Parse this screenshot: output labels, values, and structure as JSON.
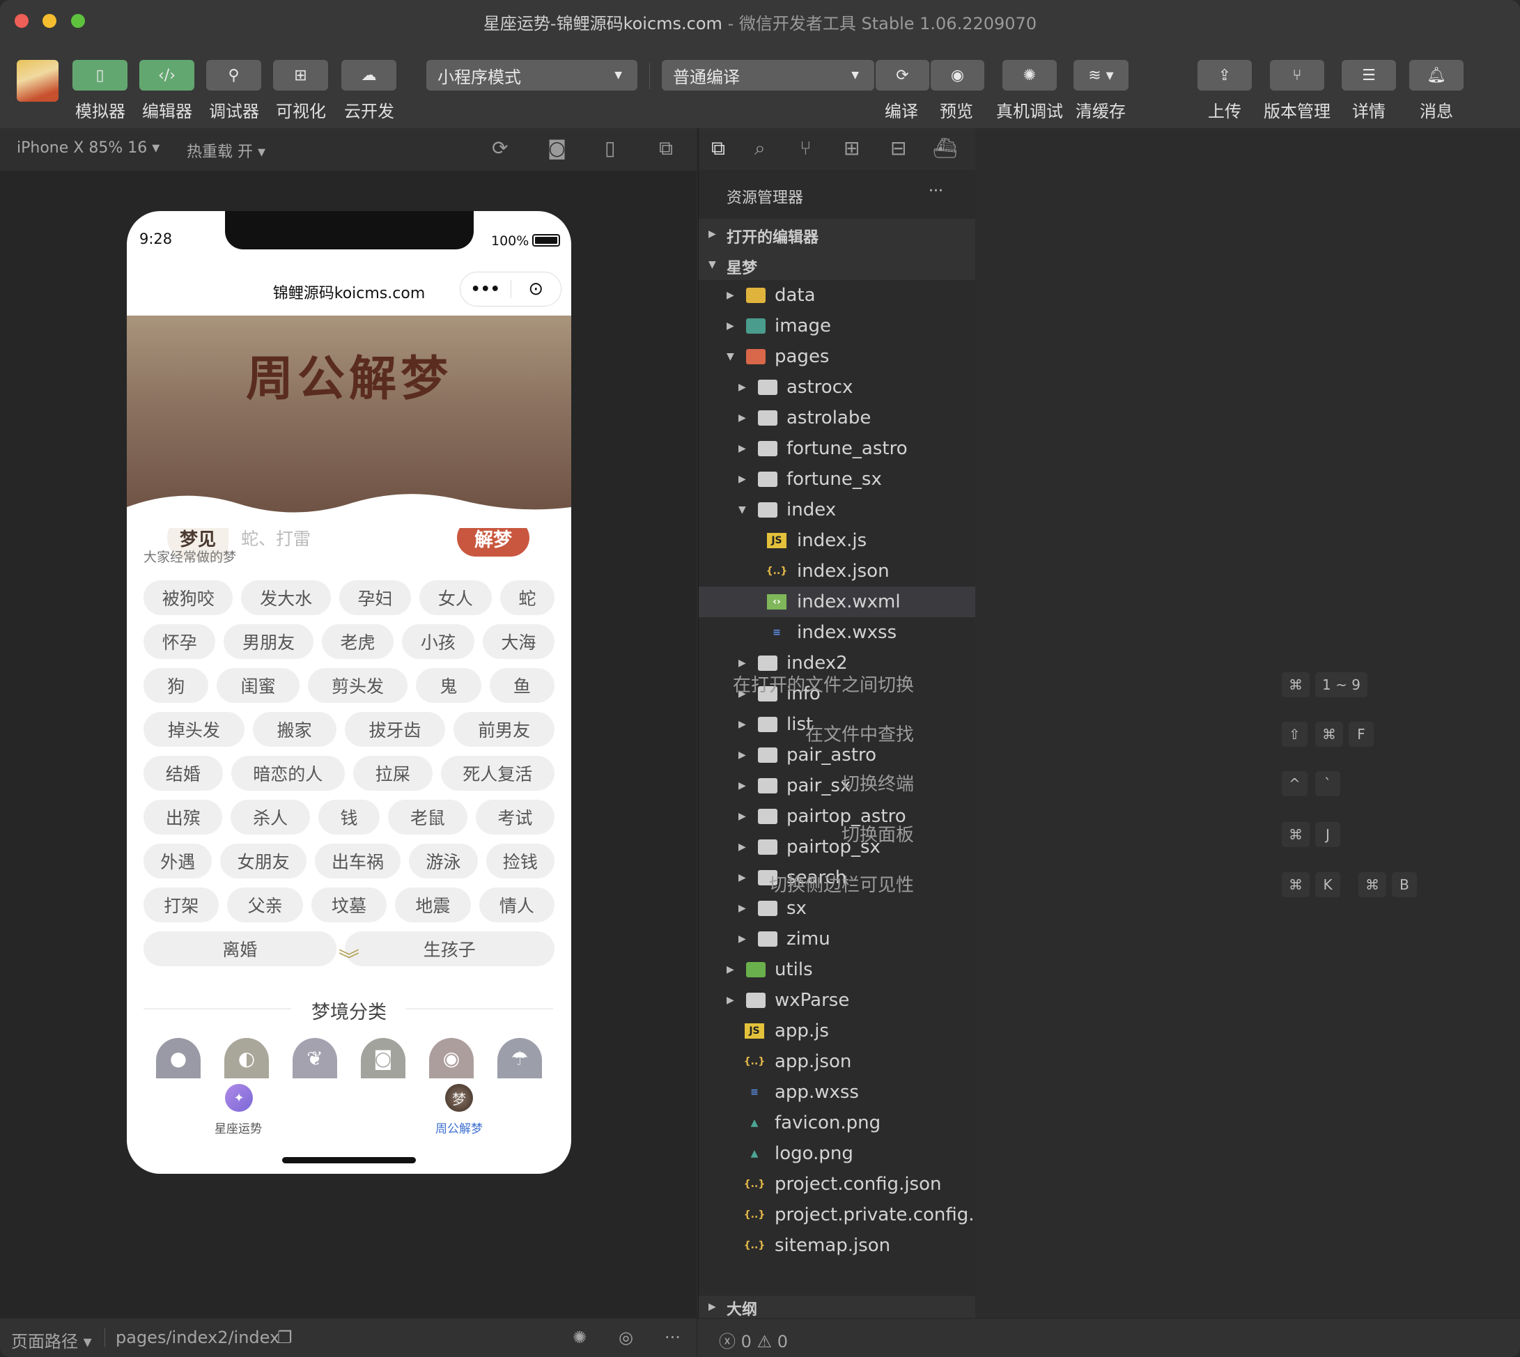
{
  "window": {
    "title_main": "星座运势-锦鲤源码koicms.com",
    "title_sep": " - ",
    "title_app": "微信开发者工具 Stable 1.06.2209070"
  },
  "toolbar": {
    "left_buttons": [
      {
        "label": "模拟器",
        "icon": "phone-icon",
        "active": true
      },
      {
        "label": "编辑器",
        "icon": "code-icon",
        "active": true
      },
      {
        "label": "调试器",
        "icon": "debug-sliders-icon",
        "active": false
      },
      {
        "label": "可视化",
        "icon": "layout-icon",
        "active": false
      },
      {
        "label": "云开发",
        "icon": "cloud-icon",
        "active": false
      }
    ],
    "mode_select": "小程序模式",
    "compile_select": "普通编译",
    "compile_label": "编译",
    "preview_label": "预览",
    "remote_debug_label": "真机调试",
    "clear_cache_label": "清缓存",
    "right_buttons": [
      {
        "label": "上传",
        "icon": "upload-icon"
      },
      {
        "label": "版本管理",
        "icon": "branch-icon"
      },
      {
        "label": "详情",
        "icon": "menu-icon"
      },
      {
        "label": "消息",
        "icon": "bell-icon"
      }
    ]
  },
  "simulator": {
    "device": "iPhone X 85% 16 ▾",
    "hot_reload": "热重载 开 ▾"
  },
  "phone": {
    "time": "9:28",
    "battery": "100%",
    "nav_title": "锦鲤源码koicms.com",
    "banner_title": "周公解梦",
    "search_prefix": "梦见",
    "search_placeholder": "蛇、打雷",
    "search_button": "解梦",
    "section_label": "大家经常做的梦",
    "tags": [
      "被狗咬",
      "发大水",
      "孕妇",
      "女人",
      "蛇",
      "怀孕",
      "男朋友",
      "老虎",
      "小孩",
      "大海",
      "狗",
      "闺蜜",
      "剪头发",
      "鬼",
      "鱼",
      "掉头发",
      "搬家",
      "拔牙齿",
      "前男友",
      "结婚",
      "暗恋的人",
      "拉屎",
      "死人复活",
      "出殡",
      "杀人",
      "钱",
      "老鼠",
      "考试",
      "外遇",
      "女朋友",
      "出车祸",
      "游泳",
      "捡钱",
      "打架",
      "父亲",
      "坟墓",
      "地震",
      "情人",
      "离婚",
      "生孩子"
    ],
    "category_title": "梦境分类",
    "categories": [
      {
        "icon": "person-icon",
        "color": "#9a9aa6"
      },
      {
        "icon": "duck-icon",
        "color": "#a9a69a"
      },
      {
        "icon": "tulip-icon",
        "color": "#a5a2b0"
      },
      {
        "icon": "camera-icon",
        "color": "#a3a39e"
      },
      {
        "icon": "eye-icon",
        "color": "#ad9e9e"
      },
      {
        "icon": "umbrella-icon",
        "color": "#9c9eaa"
      }
    ],
    "tabs": [
      {
        "label": "星座运势",
        "active": false
      },
      {
        "label": "周公解梦",
        "active": true
      }
    ],
    "active_tab_color": "#3d6fd1"
  },
  "explorer": {
    "title": "资源管理器",
    "more": "···",
    "open_editors": "打开的编辑器",
    "project": "星梦",
    "outline": "大纲",
    "tree": [
      {
        "name": "data",
        "level": 1,
        "type": "folder",
        "color": "#e0b43c",
        "open": false
      },
      {
        "name": "image",
        "level": 1,
        "type": "folder",
        "color": "#4a9c8c",
        "open": false
      },
      {
        "name": "pages",
        "level": 1,
        "type": "folder",
        "color": "#d9674a",
        "open": true
      },
      {
        "name": "astrocx",
        "level": 2,
        "type": "folder",
        "open": false
      },
      {
        "name": "astrolabe",
        "level": 2,
        "type": "folder",
        "open": false
      },
      {
        "name": "fortune_astro",
        "level": 2,
        "type": "folder",
        "open": false
      },
      {
        "name": "fortune_sx",
        "level": 2,
        "type": "folder",
        "open": false
      },
      {
        "name": "index",
        "level": 2,
        "type": "folder",
        "open": true
      },
      {
        "name": "index.js",
        "level": 3,
        "type": "js"
      },
      {
        "name": "index.json",
        "level": 3,
        "type": "json"
      },
      {
        "name": "index.wxml",
        "level": 3,
        "type": "wxml",
        "selected": true
      },
      {
        "name": "index.wxss",
        "level": 3,
        "type": "wxss"
      },
      {
        "name": "index2",
        "level": 2,
        "type": "folder",
        "open": false
      },
      {
        "name": "info",
        "level": 2,
        "type": "folder",
        "open": false
      },
      {
        "name": "list",
        "level": 2,
        "type": "folder",
        "open": false
      },
      {
        "name": "pair_astro",
        "level": 2,
        "type": "folder",
        "open": false
      },
      {
        "name": "pair_sx",
        "level": 2,
        "type": "folder",
        "open": false
      },
      {
        "name": "pairtop_astro",
        "level": 2,
        "type": "folder",
        "open": false
      },
      {
        "name": "pairtop_sx",
        "level": 2,
        "type": "folder",
        "open": false
      },
      {
        "name": "search",
        "level": 2,
        "type": "folder",
        "open": false
      },
      {
        "name": "sx",
        "level": 2,
        "type": "folder",
        "open": false
      },
      {
        "name": "zimu",
        "level": 2,
        "type": "folder",
        "open": false
      },
      {
        "name": "utils",
        "level": 1,
        "type": "folder",
        "color": "#6ab04c",
        "open": false
      },
      {
        "name": "wxParse",
        "level": 1,
        "type": "folder",
        "open": false
      },
      {
        "name": "app.js",
        "level": 1,
        "type": "js"
      },
      {
        "name": "app.json",
        "level": 1,
        "type": "json"
      },
      {
        "name": "app.wxss",
        "level": 1,
        "type": "wxss"
      },
      {
        "name": "favicon.png",
        "level": 1,
        "type": "png"
      },
      {
        "name": "logo.png",
        "level": 1,
        "type": "png"
      },
      {
        "name": "project.config.json",
        "level": 1,
        "type": "json"
      },
      {
        "name": "project.private.config...",
        "level": 1,
        "type": "json"
      },
      {
        "name": "sitemap.json",
        "level": 1,
        "type": "json"
      }
    ]
  },
  "shortcuts": [
    {
      "label": "在打开的文件之间切换",
      "keys": [
        "⌘",
        "1 ~ 9"
      ]
    },
    {
      "label": "在文件中查找",
      "keys": [
        "⇧",
        "⌘",
        "F"
      ]
    },
    {
      "label": "切换终端",
      "keys": [
        "^",
        "`"
      ]
    },
    {
      "label": "切换面板",
      "keys": [
        "⌘",
        "J"
      ]
    },
    {
      "label": "切换侧边栏可见性",
      "keys": [
        "⌘",
        "K",
        "⌘",
        "B"
      ]
    }
  ],
  "statusbar": {
    "page_path_label": "页面路径 ▾",
    "page_path": "pages/index2/index",
    "errors": "0",
    "warnings": "0"
  }
}
